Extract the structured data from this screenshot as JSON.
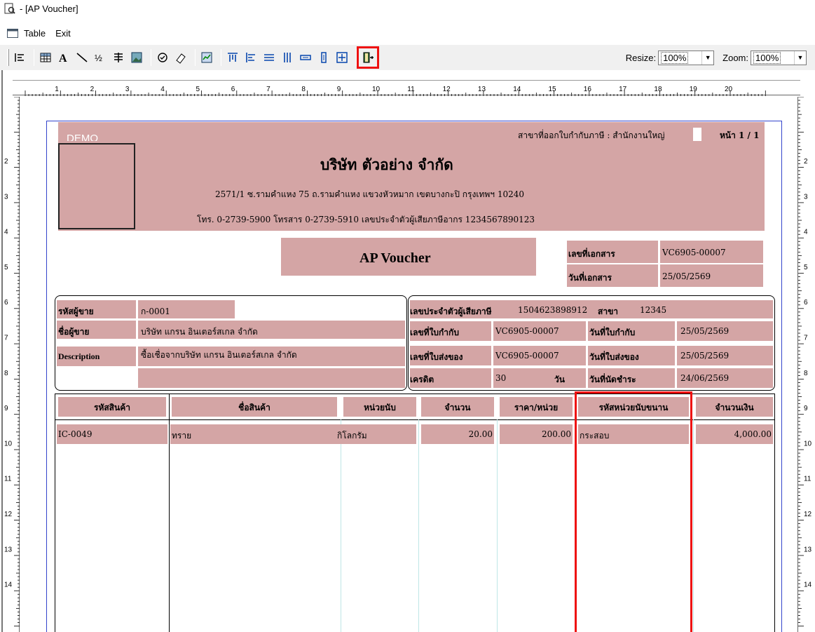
{
  "window": {
    "title": "- [AP Voucher]"
  },
  "menu": {
    "items": [
      "Table",
      "Exit"
    ]
  },
  "toolbar": {
    "resize_label": "Resize:",
    "resize_value": "100%",
    "zoom_label": "Zoom:",
    "zoom_value": "100%",
    "highlight_color": "#ee1111"
  },
  "ruler": {
    "marks": [
      "1",
      "2",
      "3",
      "4",
      "5",
      "6",
      "7",
      "8",
      "9",
      "10",
      "11",
      "12",
      "13",
      "14",
      "15",
      "16",
      "17",
      "18",
      "19",
      "20"
    ],
    "vmarks": [
      "2",
      "3",
      "4",
      "5",
      "6",
      "7",
      "8",
      "9",
      "10",
      "11",
      "12",
      "13",
      "14"
    ]
  },
  "header": {
    "demo": "DEMO",
    "branch": "สาขาที่ออกใบกำกับภาษี : สำนักงานใหญ่",
    "page": "หน้า 1 / 1",
    "company": "บริษัท ตัวอย่าง จำกัด",
    "address": "2571/1 ซ.รามคำแหง 75 ถ.รามคำแหง แขวงหัวหมาก เขตบางกะปิ กรุงเทพฯ 10240",
    "contact": "โทร. 0-2739-5900  โทรสาร 0-2739-5910  เลขประจำตัวผู้เสียภาษีอากร 1234567890123",
    "doc_title": "AP Voucher",
    "doc_no_label": "เลขที่เอกสาร",
    "doc_no": "VC6905-00007",
    "doc_date_label": "วันที่เอกสาร",
    "doc_date": "25/05/2569"
  },
  "vendor": {
    "code_label": "รหัสผู้ขาย",
    "code": "ก-0001",
    "name_label": "ชื่อผู้ขาย",
    "name": "บริษัท แกรน อินเตอร์สเกล จำกัด",
    "desc_label": "Description",
    "desc": "ซื้อเชื่อจากบริษัท แกรน อินเตอร์สเกล จำกัด"
  },
  "tax": {
    "taxid_label": "เลขประจำตัวผู้เสียภาษี",
    "taxid": "1504623898912",
    "branch_label": "สาขา",
    "branch": "12345",
    "inv_no_label": "เลขที่ใบกำกับ",
    "inv_no": "VC6905-00007",
    "inv_date_label": "วันที่ใบกำกับ",
    "inv_date": "25/05/2569",
    "del_no_label": "เลขที่ใบส่งของ",
    "del_no": "VC6905-00007",
    "del_date_label": "วันที่ใบส่งของ",
    "del_date": "25/05/2569",
    "credit_label": "เครดิต",
    "credit": "30",
    "day_label": "วัน",
    "due_label": "วันที่นัดชำระ",
    "due": "24/06/2569"
  },
  "table": {
    "headers": [
      "รหัสสินค้า",
      "ชื่อสินค้า",
      "หน่วยนับ",
      "จำนวน",
      "ราคา/หน่วย",
      "รหัสหน่วยนับขนาน",
      "จำนวนเงิน"
    ],
    "rows": [
      [
        "IC-0049",
        "ทราย",
        "กิโลกรัม",
        "20.00",
        "200.00",
        "กระสอบ",
        "4,000.00"
      ]
    ]
  }
}
